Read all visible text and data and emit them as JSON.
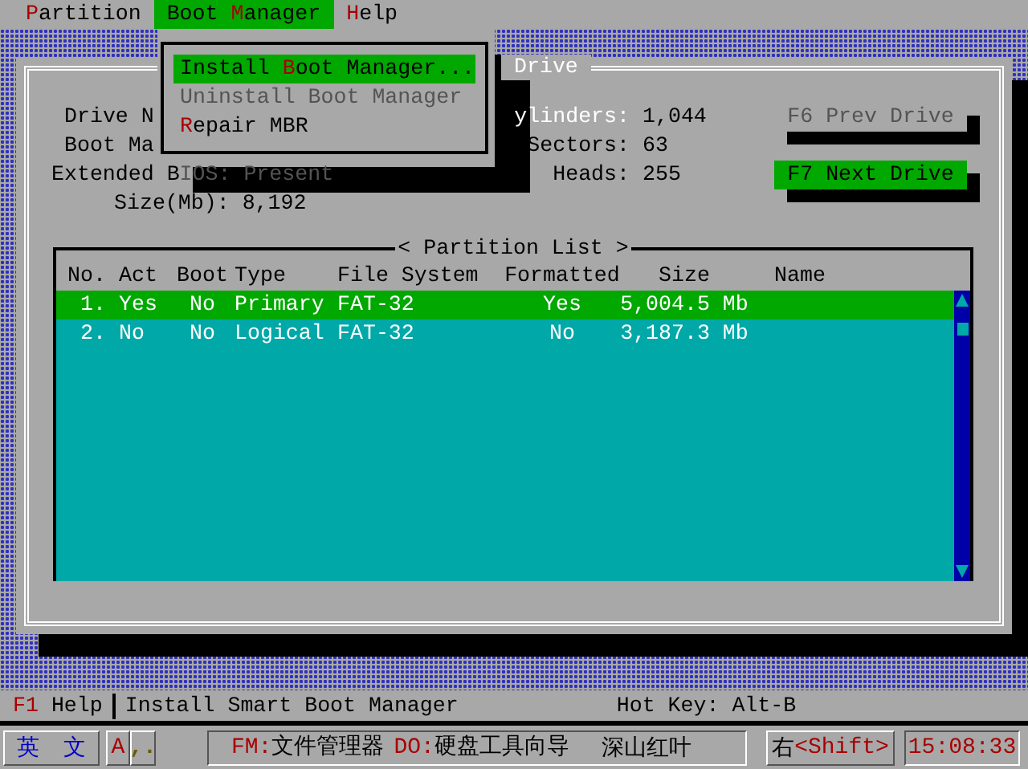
{
  "menu_bar": [
    {
      "hotkey": "P",
      "after": "artition",
      "selected": false
    },
    {
      "before": "Boot ",
      "hotkey": "M",
      "after": "anager",
      "selected": true
    },
    {
      "hotkey": "H",
      "after": "elp",
      "selected": false
    }
  ],
  "dropdown": [
    {
      "before": "Install ",
      "hotkey": "B",
      "after": "oot Manager...",
      "selected": true,
      "disabled": false
    },
    {
      "before": "Uninstall Boot Manager",
      "selected": false,
      "disabled": true
    },
    {
      "hotkey": "R",
      "after": "epair MBR",
      "selected": false,
      "disabled": false
    }
  ],
  "dialog": {
    "title": "Drive",
    "info_left": [
      "Drive N",
      "Boot Ma",
      "Extended B",
      "Size(Mb):"
    ],
    "bios_value": "IOS: Present",
    "size_value": "8,192",
    "info_right": [
      {
        "label": "ylinders:",
        "value": "1,044"
      },
      {
        "label": "Sectors:",
        "value": "63"
      },
      {
        "label": "Heads:",
        "value": "255"
      }
    ],
    "buttons": [
      {
        "label": "F6 Prev Drive",
        "disabled": true
      },
      {
        "label": "F7 Next Drive",
        "disabled": false
      }
    ],
    "partition_list": {
      "title": "< Partition List >",
      "columns": [
        "No.",
        "Act",
        "Boot",
        "Type",
        "File System",
        "Formatted",
        "Size",
        "Name"
      ],
      "rows": [
        {
          "cells": [
            "1.",
            "Yes",
            "No",
            "Primary",
            "FAT-32",
            "Yes",
            "5,004.5 Mb"
          ],
          "selected": true
        },
        {
          "cells": [
            "2.",
            "No",
            "No",
            "Logical",
            "FAT-32",
            "No",
            "3,187.3 Mb"
          ],
          "selected": false
        }
      ]
    }
  },
  "status_bar": {
    "key": "F1",
    "label": "Help",
    "hint": "Install Smart Boot Manager",
    "hot_key": "Hot Key: Alt-B"
  },
  "taskbar": {
    "ime": [
      "英",
      "文"
    ],
    "mode": "A",
    "punct": ",.",
    "commands": [
      {
        "key": "FM:",
        "label": "文件管理器"
      },
      {
        "key": "DO:",
        "label": "硬盘工具向导"
      }
    ],
    "brand": "深山红叶",
    "shift_side": "右",
    "shift": "<Shift>",
    "time": "15:08:33"
  }
}
